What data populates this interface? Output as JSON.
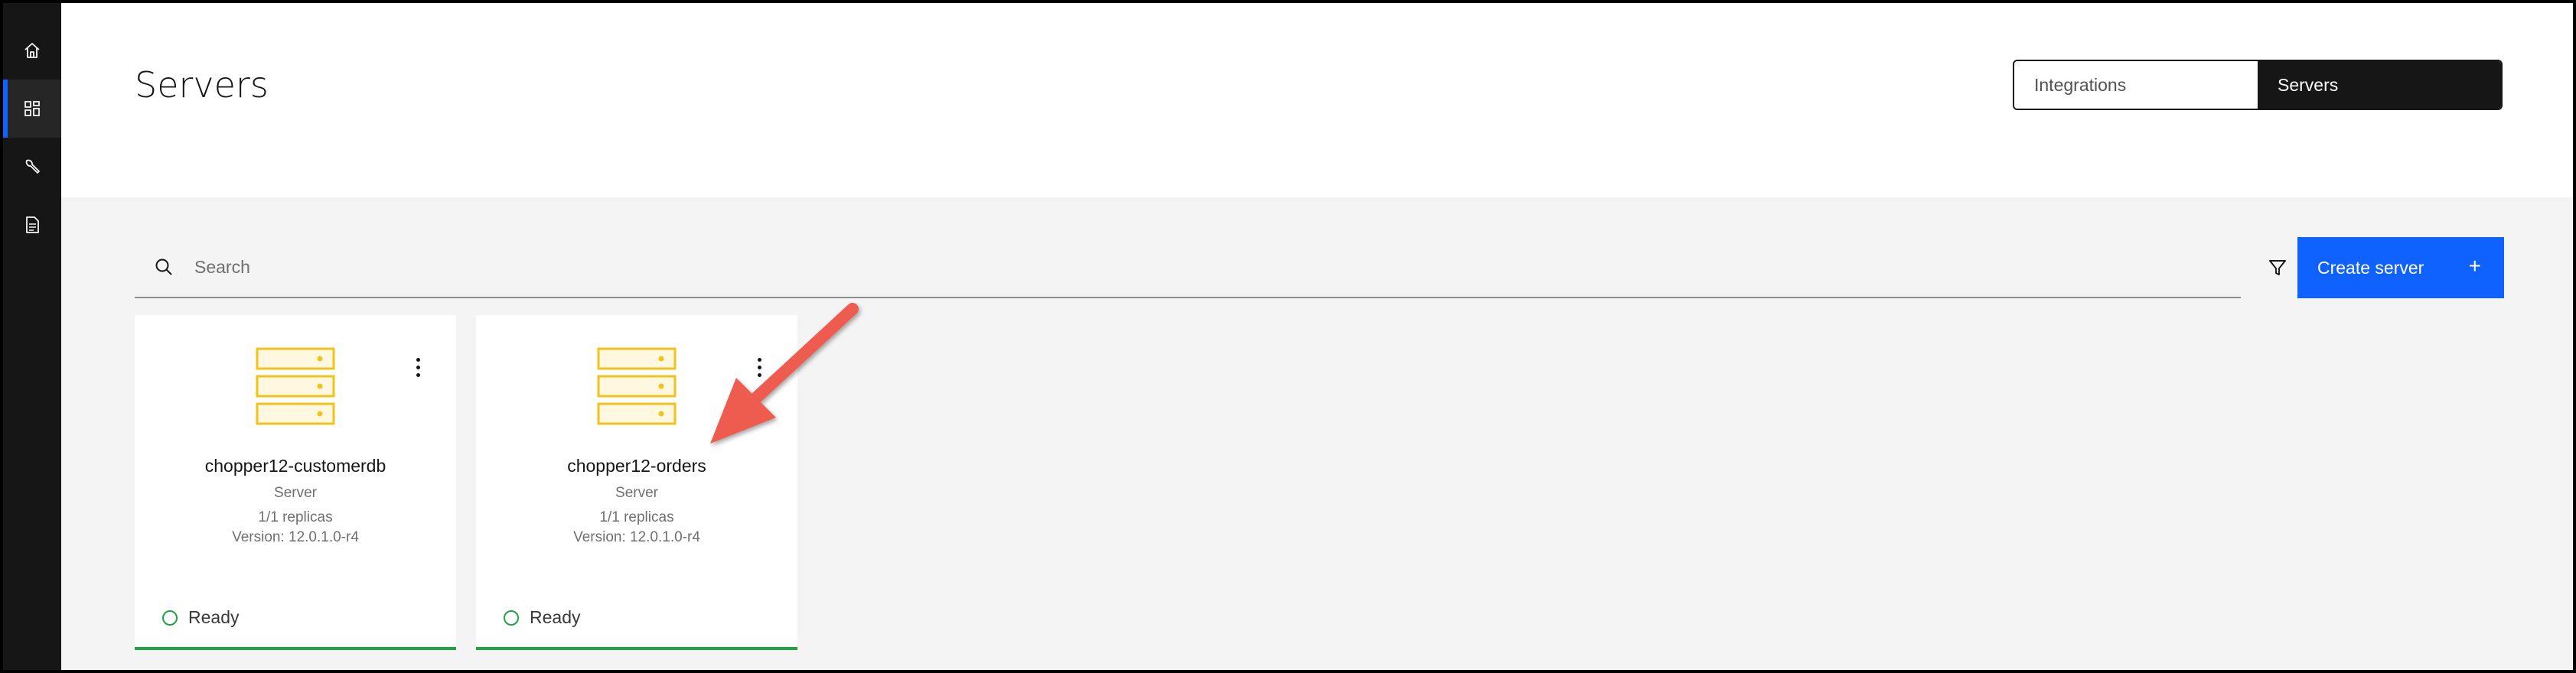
{
  "sidebar": {
    "items": [
      {
        "icon": "home-icon",
        "active": false
      },
      {
        "icon": "dashboard-icon",
        "active": true
      },
      {
        "icon": "wrench-icon",
        "active": false
      },
      {
        "icon": "document-icon",
        "active": false
      }
    ]
  },
  "header": {
    "title": "Servers",
    "switcher": {
      "options": [
        "Integrations",
        "Servers"
      ],
      "selected": "Servers"
    }
  },
  "toolbar": {
    "search_placeholder": "Search",
    "search_value": "",
    "create_label": "Create server",
    "create_icon": "+"
  },
  "cards": [
    {
      "name": "chopper12-customerdb",
      "type": "Server",
      "replicas": "1/1 replicas",
      "version": "Version: 12.0.1.0-r4",
      "status": "Ready"
    },
    {
      "name": "chopper12-orders",
      "type": "Server",
      "replicas": "1/1 replicas",
      "version": "Version: 12.0.1.0-r4",
      "status": "Ready"
    }
  ],
  "colors": {
    "accent": "#0f62fe",
    "sidebar": "#161616",
    "ready": "#24a148",
    "server_icon": "#f1c21b",
    "annotation_arrow": "#ee5b50"
  }
}
